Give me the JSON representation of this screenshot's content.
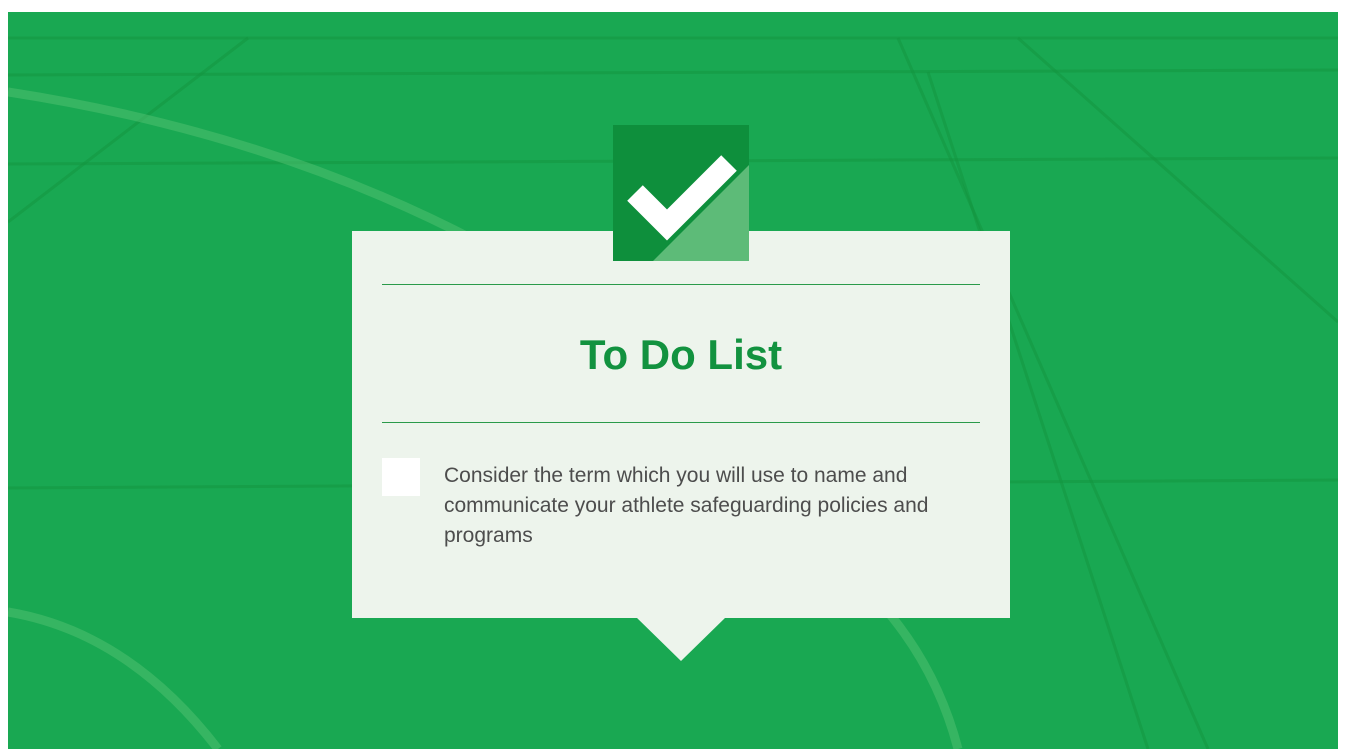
{
  "slide": {
    "title": "To Do List",
    "checkbox_checked": false,
    "task_text": "Consider the term which you will use to name and communicate your athlete safeguarding policies and programs"
  },
  "colors": {
    "background": "#19a852",
    "card": "#edf4ec",
    "title": "#12923f",
    "badge_dark": "#0e8f3c",
    "badge_light": "#5dbb78",
    "rule": "#2a9a4a",
    "body_text": "#4d4d4d"
  },
  "icons": {
    "badge": "checkmark-icon"
  }
}
